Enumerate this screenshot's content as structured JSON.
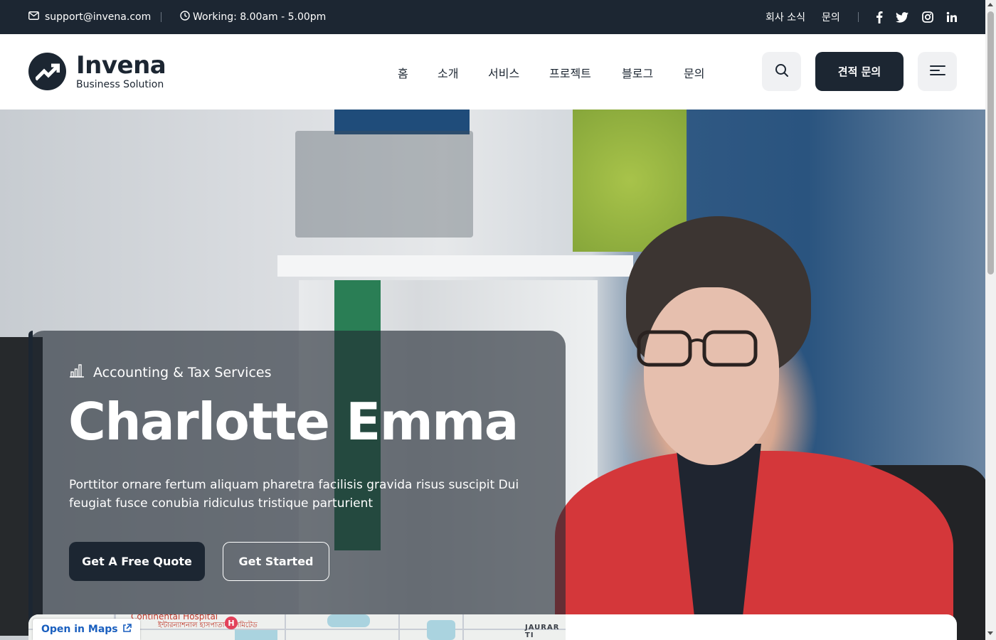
{
  "topbar": {
    "email": "support@invena.com",
    "hours": "Working: 8.00am - 5.00pm",
    "links": [
      "회사 소식",
      "문의"
    ],
    "social": [
      "facebook-icon",
      "twitter-icon",
      "instagram-icon",
      "linkedin-icon"
    ]
  },
  "header": {
    "logo_name": "Invena",
    "logo_tagline": "Business Solution",
    "nav": [
      "홈",
      "소개",
      "서비스",
      "프로젝트",
      "블로그",
      "문의"
    ],
    "quote_button": "견적 문의"
  },
  "hero": {
    "eyebrow": "Accounting & Tax Services",
    "title": "Charlotte Emma",
    "description": "Porttitor ornare fertum aliquam pharetra facilisis gravida risus suscipit Dui feugiat fusce conubia ridiculus tristique parturient",
    "primary_button": "Get A Free Quote",
    "secondary_button": "Get Started"
  },
  "map": {
    "open_in_maps": "Open in Maps",
    "poi_name": "Continental Hospital",
    "poi_local": "ইন্টারন্যাশনাল হাসপাতাল লিমিটেড",
    "pin_label": "H",
    "area_label": "JAURAR TI"
  },
  "colors": {
    "primary": "#1c2632",
    "hero_overlay": "rgba(32,40,50,0.62)",
    "map_link": "#1a5fbf"
  }
}
